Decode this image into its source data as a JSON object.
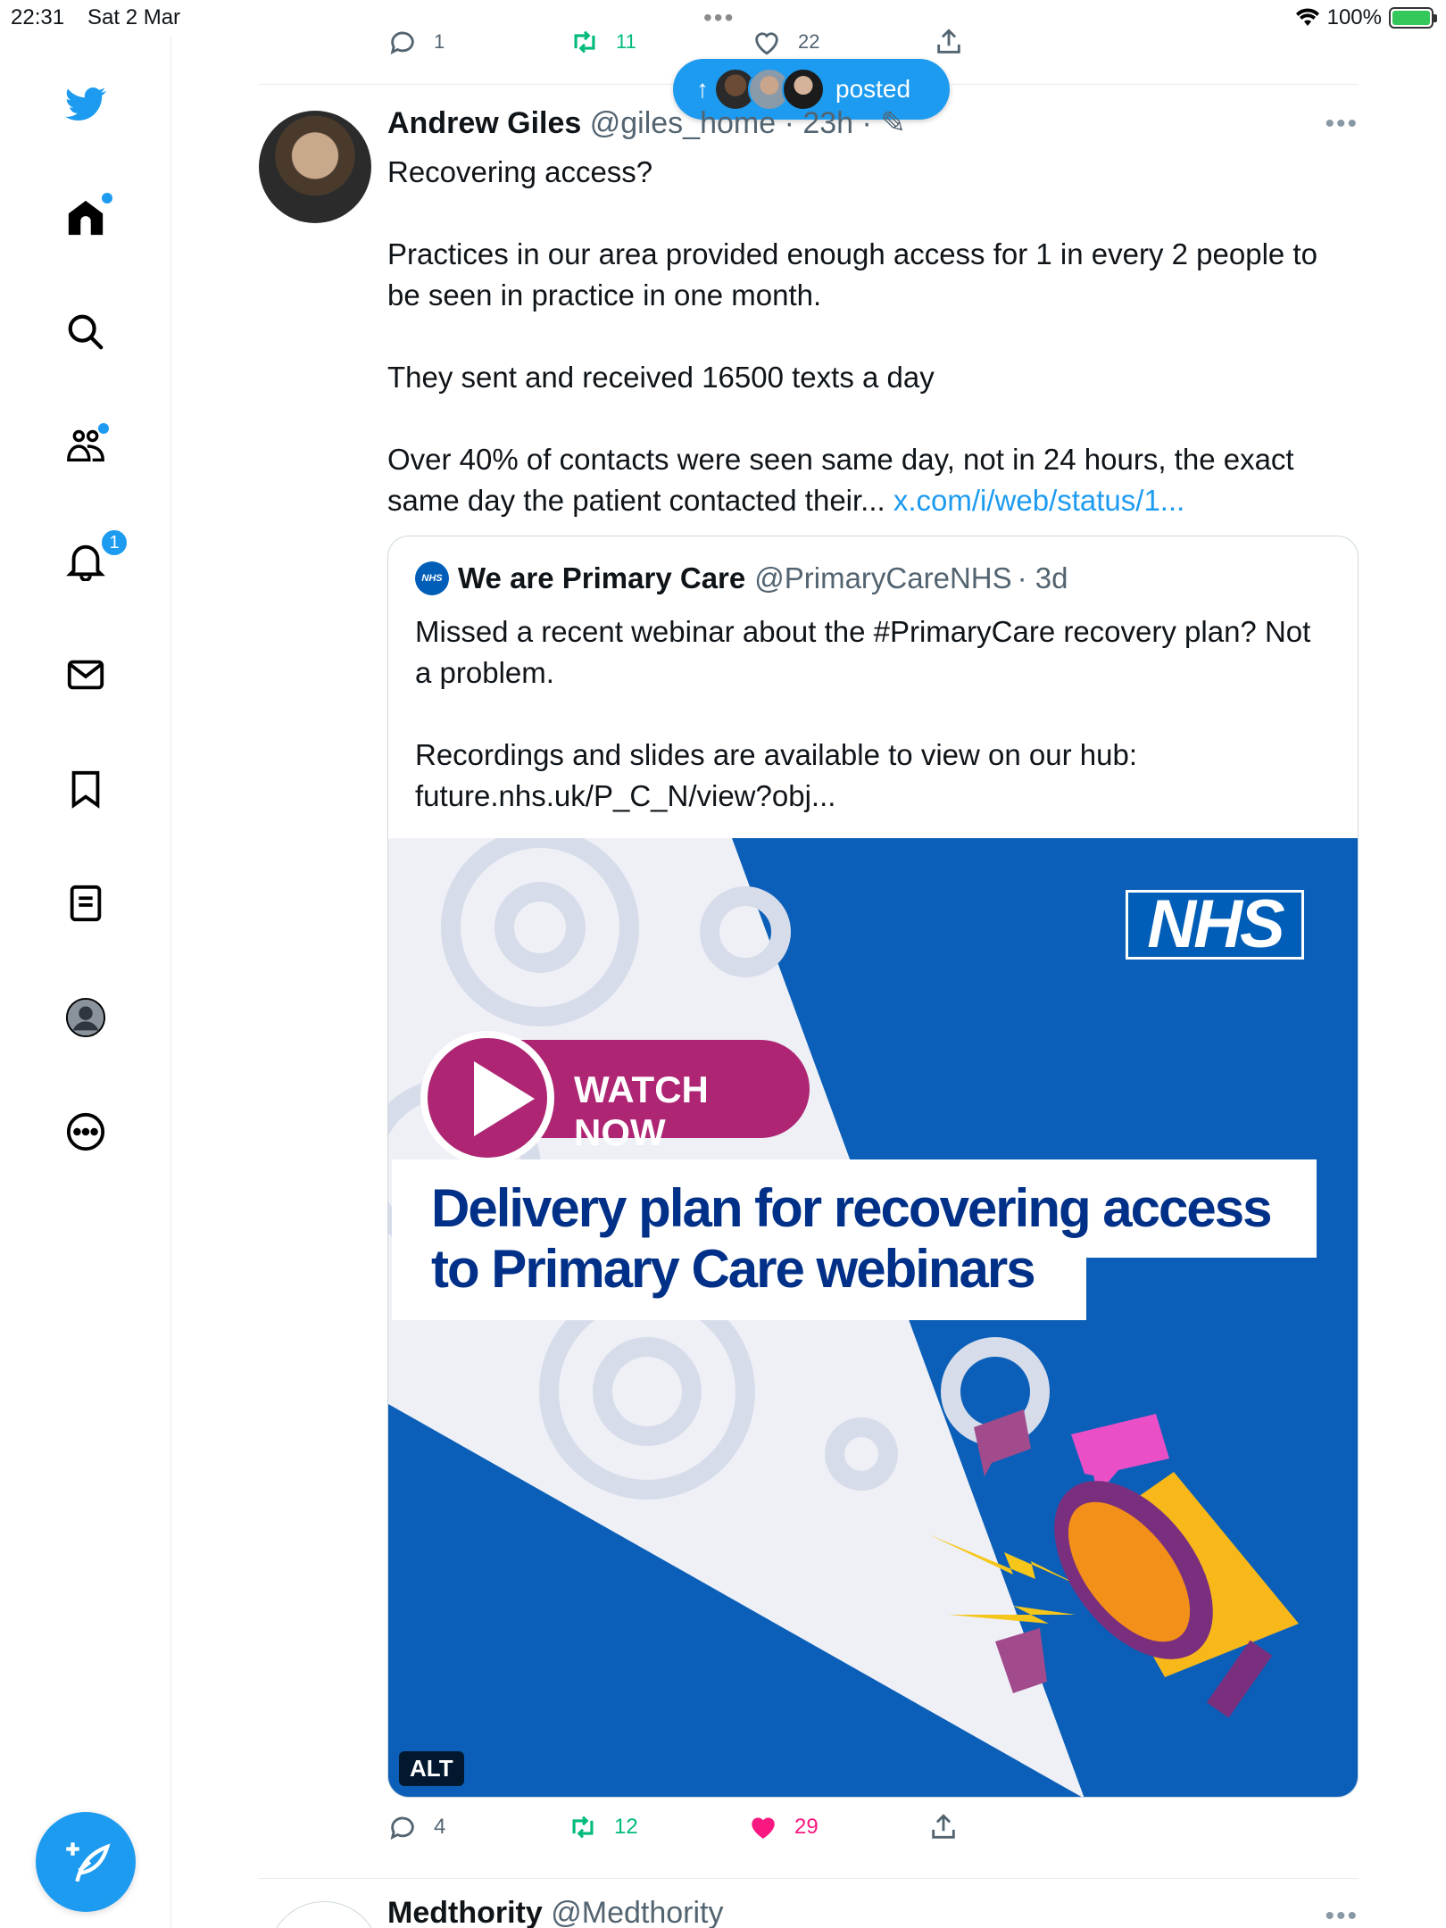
{
  "status": {
    "time": "22:31",
    "date": "Sat 2 Mar",
    "battery": "100%"
  },
  "sidebar": {
    "notifications_badge": "1",
    "icons": [
      "twitter-bird-icon",
      "home-icon",
      "search-icon",
      "communities-icon",
      "notifications-icon",
      "messages-icon",
      "bookmarks-icon",
      "lists-icon",
      "profile-icon",
      "more-icon"
    ]
  },
  "previous_tweet": {
    "replies": "1",
    "retweets": "11",
    "likes": "22"
  },
  "new_posts_pill": {
    "label": "posted"
  },
  "tweet": {
    "name": "Andrew Giles",
    "handle": "@giles_home",
    "time": "· 23h ·",
    "body_1": "Recovering access?\n\nPractices in our area provided enough access for 1 in every 2 people to be seen in practice in one month.\n\nThey sent and received 16500 texts a day\n\nOver 40% of contacts were seen same day, not in 24 hours, the exact same day the patient contacted their... ",
    "link": "x.com/i/web/status/1...",
    "quote": {
      "name": "We are Primary Care",
      "handle": "@PrimaryCareNHS",
      "time": "· 3d",
      "nhs_badge": "NHS",
      "body": "Missed a recent webinar about the #PrimaryCare recovery plan? Not a problem.\n\nRecordings and slides are available to view on our hub: future.nhs.uk/P_C_N/view?obj...",
      "media": {
        "logo": "NHS",
        "button": "WATCH NOW",
        "headline_1": "Delivery plan for recovering access",
        "headline_2": "to Primary Care webinars",
        "alt": "ALT"
      }
    },
    "replies": "4",
    "retweets": "12",
    "likes": "29"
  },
  "next_tweet": {
    "name": "Medthority",
    "handle": "@Medthority"
  },
  "colors": {
    "accent": "#1d9bf0",
    "retweet": "#00ba7c",
    "like": "#f91880",
    "nhs_blue": "#005eb8",
    "nhs_magenta": "#ae2573"
  }
}
